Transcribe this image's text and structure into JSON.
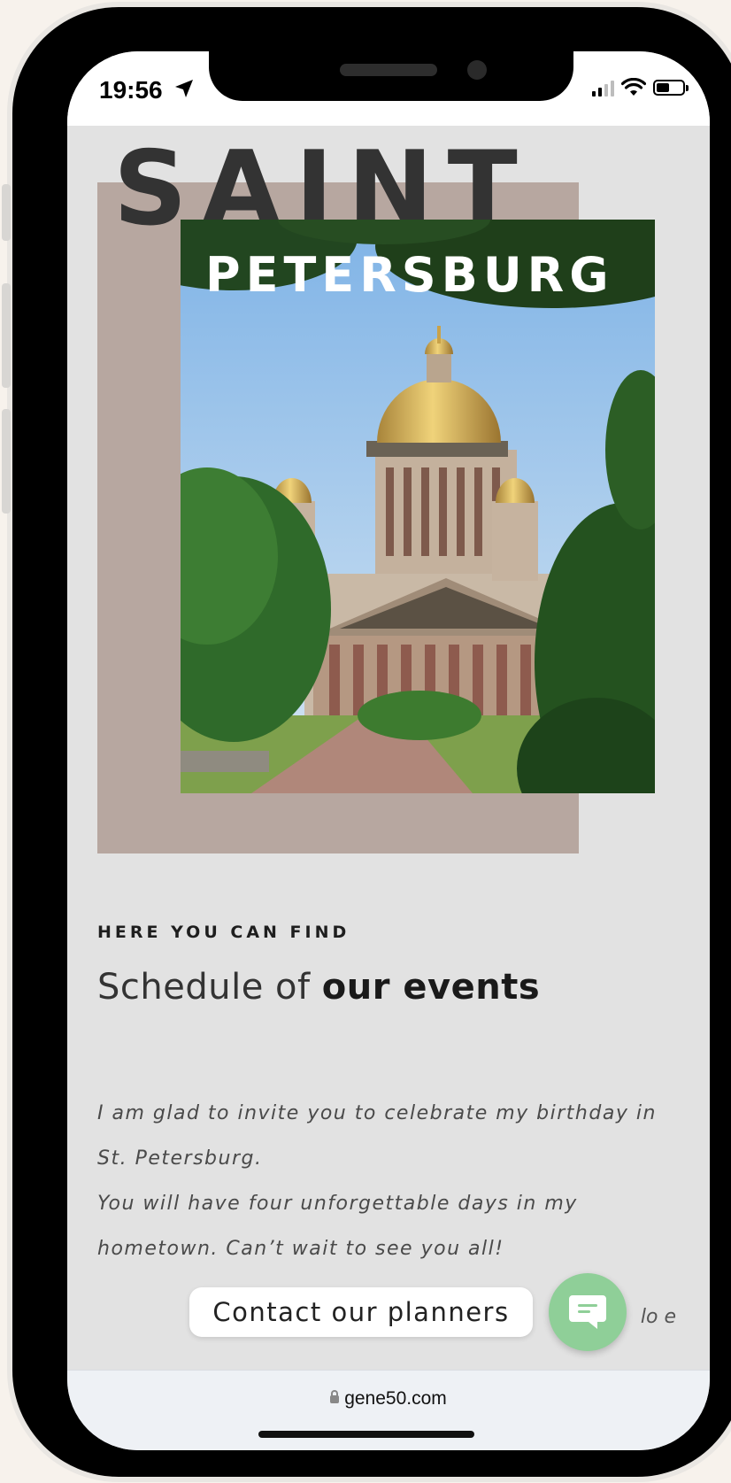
{
  "status_bar": {
    "time": "19:56",
    "icons": [
      "location-arrow-icon",
      "signal-icon",
      "wifi-icon",
      "battery-icon"
    ]
  },
  "hero": {
    "title_top": "SAINT",
    "title_bottom": "PETERSBURG",
    "image": "saint-isaacs-cathedral-photo"
  },
  "section": {
    "kicker": "HERE YOU CAN FIND",
    "heading_light": "Schedule of",
    "heading_bold": "our events",
    "paragraph_1": "I am glad to invite you to celebrate my birthday in St. Petersburg.",
    "paragraph_2": "You will have four unforgettable days in my hometown. Can’t wait to see you all!",
    "trailing_text": "lo        e"
  },
  "widgets": {
    "contact_label": "Contact our planners",
    "chat_icon": "chat-bubble-icon"
  },
  "browser": {
    "url": "gene50.com"
  },
  "colors": {
    "taupe": "#b7a7a0",
    "background": "#e2e2e2",
    "chat_green": "#8fcf98",
    "title_dark": "#333333"
  }
}
